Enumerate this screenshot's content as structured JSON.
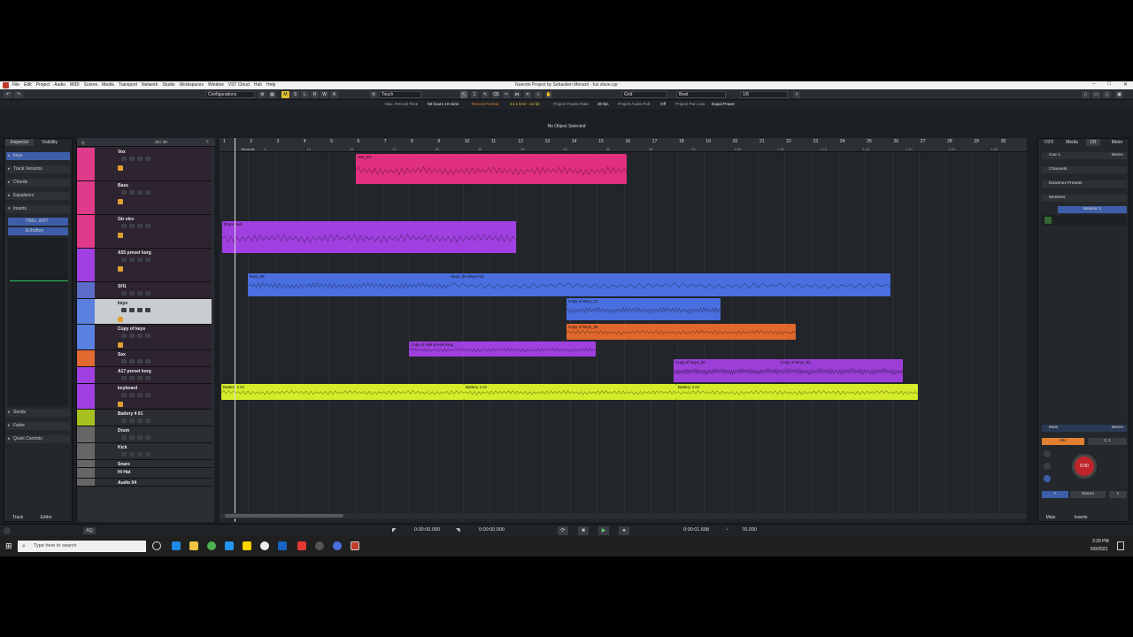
{
  "window": {
    "title": "Nuendo Project by Sebastien Menard - fun slave.cpr",
    "menu": [
      "File",
      "Edit",
      "Project",
      "Audio",
      "MIDI",
      "Scores",
      "Media",
      "Transport",
      "Network",
      "Studio",
      "Workspaces",
      "Window",
      "VST Cloud",
      "Hub",
      "Help"
    ]
  },
  "toolbar": {
    "configurations": "Configurations",
    "touch": "Touch",
    "msrwa": [
      "M",
      "S",
      "L",
      "R",
      "W",
      "A"
    ],
    "grid": "Grid",
    "beat": "Beat",
    "quantize": "1/8"
  },
  "info": {
    "max_record_label": "Max. Record Time",
    "max_record_value": "58 hours 10 mins",
    "record_format_label": "Record Format",
    "record_format_value": "44.1 kHz - 24 bit",
    "frame_rate_label": "Project Frame Rate",
    "frame_rate_value": "30 fps",
    "pull_label": "Project Audio Pull",
    "pull_value": "Off",
    "pan_label": "Project Pan Law",
    "pan_value": "Equal Power",
    "no_selection": "No Object Selected"
  },
  "inspector": {
    "tabs": [
      "Inspector",
      "Visibility"
    ],
    "track_name": "keys",
    "sections": [
      "Track Versions",
      "Chords",
      "Equalizers",
      "Inserts"
    ],
    "inserts": [
      "!!!Mo...64!!!",
      "EchoBoy"
    ],
    "bottom_sections": [
      "Sends",
      "Fader",
      "Quick Controls"
    ],
    "bottom_tabs": [
      "Track",
      "Editor"
    ]
  },
  "tracklist": {
    "count": "28 / 28",
    "tracks": [
      {
        "name": "Vox",
        "color": "#e03a8a"
      },
      {
        "name": "Bass",
        "color": "#e03a8a"
      },
      {
        "name": "Gtr elec",
        "color": "#e03a8a"
      },
      {
        "name": "A55 preset korg",
        "color": "#a040e0"
      },
      {
        "name": "SH1",
        "color": "#5a6cc8"
      },
      {
        "name": "keys",
        "color": "#5a80e0"
      },
      {
        "name": "Copy of keys",
        "color": "#5a80e0"
      },
      {
        "name": "Sax",
        "color": "#e06a30"
      },
      {
        "name": "A17 preset korg",
        "color": "#a040e0"
      },
      {
        "name": "keyboard",
        "color": "#a040e0"
      },
      {
        "name": "Battery 4 01",
        "color": "#a8c020"
      },
      {
        "name": "Drum",
        "color": "#666"
      },
      {
        "name": "Kick",
        "color": "#666"
      },
      {
        "name": "Snare",
        "color": "#666"
      },
      {
        "name": "Hi Hat",
        "color": "#666"
      },
      {
        "name": "Audio 04",
        "color": "#666"
      }
    ]
  },
  "ruler": {
    "bars": [
      "1",
      "2",
      "3",
      "4",
      "5",
      "6",
      "7",
      "8",
      "9",
      "10",
      "11",
      "12",
      "13",
      "14",
      "15",
      "16",
      "17",
      "18",
      "19",
      "20",
      "21",
      "22",
      "23",
      "24",
      "25",
      "26",
      "27",
      "28",
      "29",
      "30"
    ],
    "seconds_label": "Seconds",
    "seconds": [
      "0",
      "5",
      "10",
      "15",
      "20",
      "25",
      "30",
      "35",
      "40",
      "45",
      "50",
      "55",
      "1:00",
      "1:05",
      "1:10",
      "1:15",
      "1:20",
      "1:25",
      "1:30"
    ]
  },
  "events": [
    {
      "label": "Vox_04",
      "color": "#e0307f"
    },
    {
      "label": "Drum midi",
      "color": "#a040e0"
    },
    {
      "label": "keys_05",
      "color": "#4a6fe0"
    },
    {
      "label": "keys_05 (keys-03)",
      "color": "#4a6fe0"
    },
    {
      "label": "Copy of keys_12",
      "color": "#4a6fe0"
    },
    {
      "label": "Copy of keys_26",
      "color": "#e0682e"
    },
    {
      "label": "Copy of A55 preset korg",
      "color": "#a040e0"
    },
    {
      "label": "Copy of keys_33",
      "color": "#9b3fd8"
    },
    {
      "label": "Copy of keys_33",
      "color": "#9b3fd8"
    },
    {
      "label": "Battery 4 01",
      "color": "#d4ec2a"
    },
    {
      "label": "Battery 4 01",
      "color": "#d4ec2a"
    },
    {
      "label": "Battery 4 01",
      "color": "#d4ec2a"
    }
  ],
  "rightzone": {
    "tabs": [
      "VSTi",
      "Media",
      "CR",
      "Meter"
    ],
    "cue": "Cue 1",
    "stereo": "stereo",
    "sections": [
      "Channels",
      "Downmix Presets",
      "Monitors"
    ],
    "monitor": "Monitor 1",
    "main": "Main",
    "main_stereo": "stereo",
    "mix": "Mix",
    "c1": "C 1",
    "knob": "0.00",
    "stereo_btn": "Stereo",
    "one": "1",
    "a_btn": "A",
    "bottom_tabs": [
      "Main",
      "Inserts"
    ]
  },
  "transport": {
    "left_locator": "0:00:00.000",
    "right_locator": "0:00:00.000",
    "position": "0:00:01.698",
    "tempo": "76.000"
  },
  "taskbar": {
    "search": "Type here to search",
    "time": "2:39 PM",
    "date": "5/9/2021"
  }
}
